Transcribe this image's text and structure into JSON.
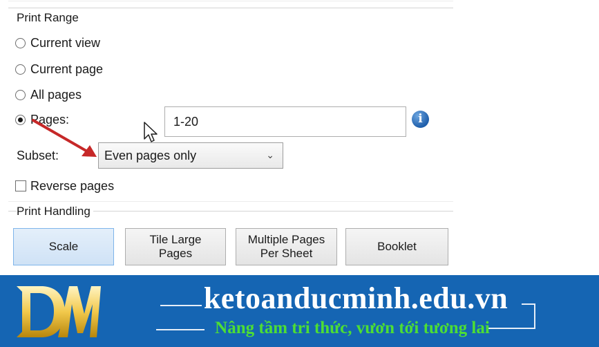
{
  "print_range": {
    "title": "Print Range",
    "options": [
      {
        "label": "Current view",
        "checked": false
      },
      {
        "label": "Current page",
        "checked": false
      },
      {
        "label": "All pages",
        "checked": false
      },
      {
        "label": "Pages:",
        "checked": true
      }
    ],
    "pages_value": "1-20",
    "info_icon": "info-icon",
    "subset_label": "Subset:",
    "subset_value": "Even pages only",
    "subset_icon": "chevron-down-icon",
    "reverse_pages_label": "Reverse pages",
    "reverse_pages_checked": false
  },
  "print_handling": {
    "title": "Print Handling",
    "buttons": [
      {
        "label": "Scale",
        "selected": true
      },
      {
        "label": "Tile Large\nPages",
        "selected": false
      },
      {
        "label": "Multiple Pages\nPer Sheet",
        "selected": false
      },
      {
        "label": "Booklet",
        "selected": false
      }
    ]
  },
  "banner": {
    "logo_icon": "dm-logo",
    "site_name": "ketoanducminh.edu.vn",
    "tagline": "Nâng tầm tri thức, vươn tới tương lai"
  },
  "colors": {
    "banner_bg": "#1565b3",
    "tagline": "#4dde34",
    "logo_gold": "#f2c94c",
    "annotation_arrow": "#c62828",
    "selected_button": "#cfe2f6"
  }
}
